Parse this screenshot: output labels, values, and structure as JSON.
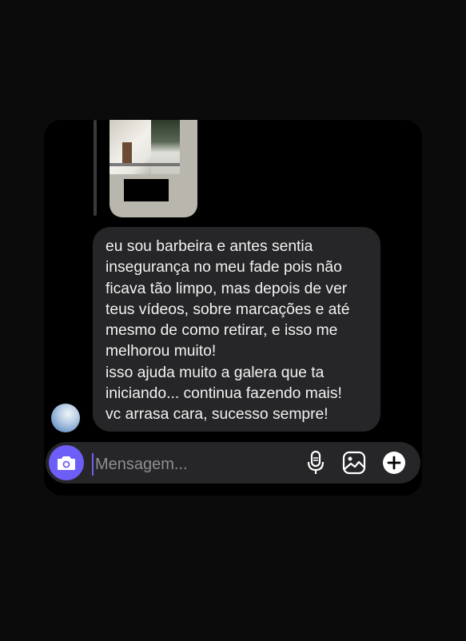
{
  "conversation": {
    "message": {
      "lines": [
        "eu sou barbeira e antes sentia",
        "insegurança no meu fade pois não",
        "ficava tão limpo, mas depois de ver",
        "teus vídeos, sobre marcações e até",
        "mesmo de como retirar, e isso me",
        "melhorou muito!",
        "isso ajuda muito a galera que ta",
        "iniciando... continua fazendo mais!",
        "vc arrasa cara, sucesso sempre!"
      ]
    }
  },
  "composer": {
    "placeholder": "Mensagem...",
    "icons": [
      "camera-icon",
      "microphone-icon",
      "gallery-icon",
      "plus-icon"
    ]
  },
  "colors": {
    "accent": "#6d5ef7",
    "bubble": "#262628",
    "background": "#000000"
  }
}
